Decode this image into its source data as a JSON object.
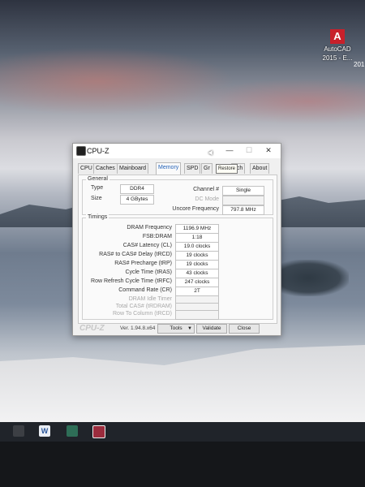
{
  "desktop": {
    "icon": {
      "label_line1": "AutoCAD",
      "label_line2": "2015 - E...",
      "glyph": "A"
    },
    "edge_text": "201"
  },
  "window": {
    "title": "CPU-Z",
    "controls": {
      "minimize": "—",
      "maximize": "☐",
      "close": "✕"
    },
    "tabs": [
      {
        "label": "CPU"
      },
      {
        "label": "Caches"
      },
      {
        "label": "Mainboard"
      },
      {
        "label": "Memory"
      },
      {
        "label": "SPD"
      },
      {
        "label": "Gr"
      },
      {
        "label": "nch"
      },
      {
        "label": "About"
      }
    ],
    "active_tab": "Memory",
    "tooltip": "Restore"
  },
  "general": {
    "title": "General",
    "type_label": "Type",
    "type_value": "DDR4",
    "size_label": "Size",
    "size_value": "4 GBytes",
    "channel_label": "Channel #",
    "channel_value": "Single",
    "dc_mode_label": "DC Mode",
    "dc_mode_value": "",
    "uncore_label": "Uncore Frequency",
    "uncore_value": "797.8 MHz"
  },
  "timings": {
    "title": "Timings",
    "rows": [
      {
        "label": "DRAM Frequency",
        "value": "1196.9 MHz"
      },
      {
        "label": "FSB:DRAM",
        "value": "1:18"
      },
      {
        "label": "CAS# Latency (CL)",
        "value": "19.0 clocks"
      },
      {
        "label": "RAS# to CAS# Delay (tRCD)",
        "value": "19 clocks"
      },
      {
        "label": "RAS# Precharge (tRP)",
        "value": "19 clocks"
      },
      {
        "label": "Cycle Time (tRAS)",
        "value": "43 clocks"
      },
      {
        "label": "Row Refresh Cycle Time (tRFC)",
        "value": "247 clocks"
      },
      {
        "label": "Command Rate (CR)",
        "value": "2T"
      }
    ],
    "dim_rows": [
      {
        "label": "DRAM Idle Timer",
        "value": ""
      },
      {
        "label": "Total CAS# (tRDRAM)",
        "value": ""
      },
      {
        "label": "Row To Column (tRCD)",
        "value": ""
      }
    ]
  },
  "footer": {
    "logo": "CPU-Z",
    "version": "Ver. 1.94.8.x64",
    "tools_label": "Tools",
    "tools_arrow": "▼",
    "validate_label": "Validate",
    "close_label": "Close"
  },
  "taskbar": {
    "word_glyph": "W"
  }
}
